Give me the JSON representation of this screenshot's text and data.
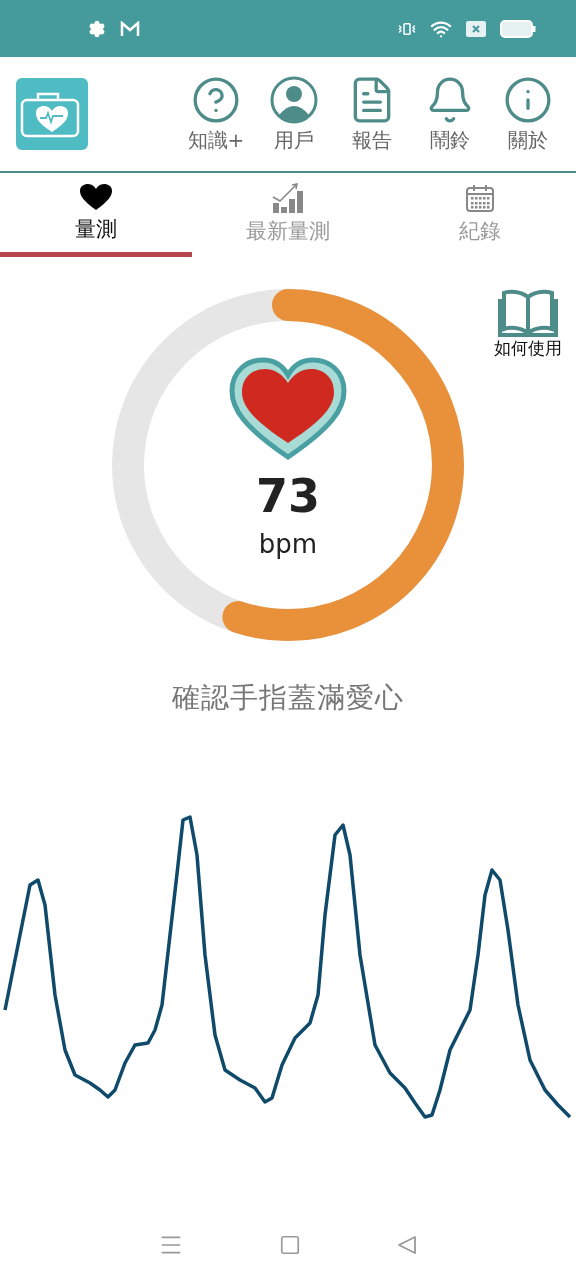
{
  "header": {
    "menu": [
      {
        "label": "知識+"
      },
      {
        "label": "用戶"
      },
      {
        "label": "報告"
      },
      {
        "label": "鬧鈴"
      },
      {
        "label": "關於"
      }
    ]
  },
  "tabs": [
    {
      "label": "量測",
      "selected": true
    },
    {
      "label": "最新量測",
      "selected": false
    },
    {
      "label": "紀錄",
      "selected": false
    }
  ],
  "gauge": {
    "value": "73",
    "unit": "bpm"
  },
  "help_button": {
    "label": "如何使用"
  },
  "instruction": "確認手指蓋滿愛心"
}
